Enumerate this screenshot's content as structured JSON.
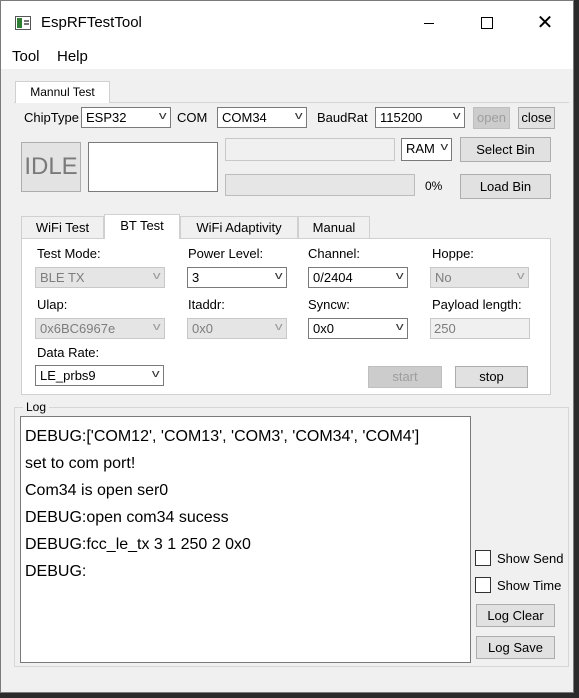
{
  "window": {
    "title": "EspRFTestTool"
  },
  "menu": {
    "items": [
      "Tool",
      "Help"
    ]
  },
  "main_tab": {
    "label": "Mannul Test"
  },
  "connection": {
    "chip_type_label": "ChipType",
    "chip_type_value": "ESP32",
    "com_label": "COM",
    "com_value": "COM34",
    "baud_label": "BaudRat",
    "baud_value": "115200",
    "open_label": "open",
    "close_label": "close"
  },
  "status": {
    "state": "IDLE",
    "message": ""
  },
  "flash": {
    "path_value": "",
    "target_value": "RAM",
    "progress_percent": 0,
    "progress_text": "0%",
    "select_bin_label": "Select Bin",
    "load_bin_label": "Load Bin"
  },
  "tabs": [
    "WiFi Test",
    "BT Test",
    "WiFi Adaptivity",
    "Manual"
  ],
  "bt": {
    "test_mode_label": "Test Mode:",
    "test_mode_value": "BLE TX",
    "power_level_label": "Power Level:",
    "power_level_value": "3",
    "channel_label": "Channel:",
    "channel_value": "0/2404",
    "hoppe_label": "Hoppe:",
    "hoppe_value": "No",
    "ulap_label": "Ulap:",
    "ulap_value": "0x6BC6967e",
    "itaddr_label": "Itaddr:",
    "itaddr_value": "0x0",
    "syncw_label": "Syncw:",
    "syncw_value": "0x0",
    "payload_label": "Payload length:",
    "payload_value": "250",
    "data_rate_label": "Data Rate:",
    "data_rate_value": "LE_prbs9",
    "start_label": "start",
    "stop_label": "stop"
  },
  "log": {
    "label": "Log",
    "lines": [
      "DEBUG:['COM12', 'COM13', 'COM3', 'COM34', 'COM4']",
      "set to com port!",
      "Com34 is open ser0",
      "DEBUG:open com34 sucess",
      "DEBUG:fcc_le_tx 3 1 250 2 0x0",
      "DEBUG:"
    ],
    "show_send_label": "Show Send",
    "show_time_label": "Show Time",
    "clear_label": "Log Clear",
    "save_label": "Log Save"
  }
}
